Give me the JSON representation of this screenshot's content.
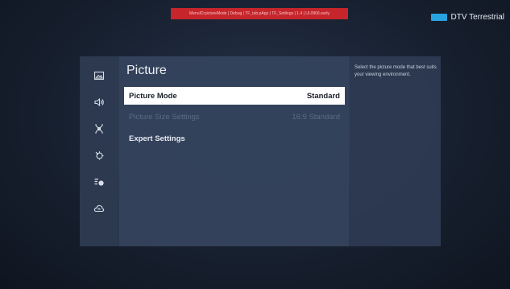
{
  "debug_bar": {
    "text": "MenuID:pictureMode | Debug | TF_tab.pApp | TF_Settings | 1.4 | UI.0906.early"
  },
  "source": {
    "label": "DTV Terrestrial",
    "icon": "tv-input-icon",
    "color": "#29a3e0"
  },
  "nav": {
    "items": [
      {
        "icon": "picture-icon",
        "name": "nav-picture"
      },
      {
        "icon": "sound-icon",
        "name": "nav-sound"
      },
      {
        "icon": "broadcasting-icon",
        "name": "nav-broadcasting"
      },
      {
        "icon": "general-icon",
        "name": "nav-general"
      },
      {
        "icon": "support-icon",
        "name": "nav-support"
      },
      {
        "icon": "network-icon",
        "name": "nav-network"
      }
    ]
  },
  "content": {
    "title": "Picture",
    "rows": [
      {
        "label": "Picture Mode",
        "value": "Standard",
        "state": "selected"
      },
      {
        "label": "Picture Size Settings",
        "value": "16:9 Standard",
        "state": "disabled"
      },
      {
        "label": "Expert Settings",
        "value": "",
        "state": "normal"
      }
    ]
  },
  "description": {
    "text": "Select the picture mode that best suits your viewing environment."
  }
}
